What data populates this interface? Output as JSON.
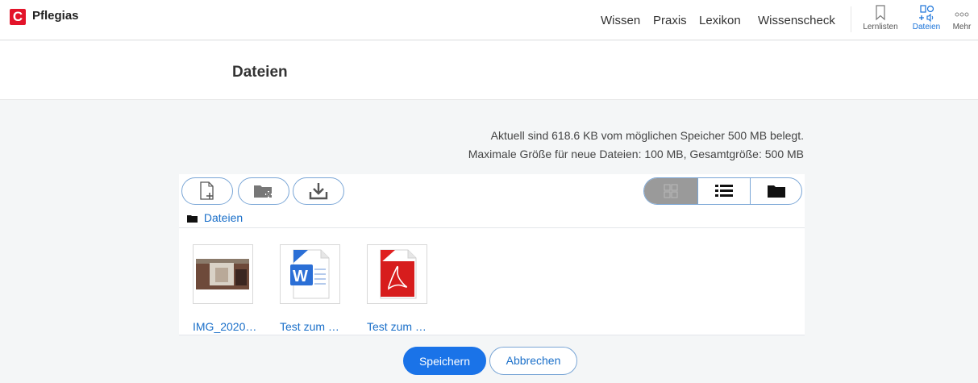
{
  "header": {
    "logo_letter": "C",
    "brand": "Pflegias",
    "nav": [
      "Wissen",
      "Praxis",
      "Lexikon",
      "Wissenscheck"
    ],
    "icon_items": [
      {
        "label": "Lernlisten",
        "icon": "bookmark-icon"
      },
      {
        "label": "Dateien",
        "icon": "files-media-icon",
        "active": true
      },
      {
        "label": "Mehr",
        "icon": "more-dots-icon"
      }
    ]
  },
  "page": {
    "title": "Dateien"
  },
  "storage": {
    "line1": "Aktuell sind 618.6 KB vom möglichen Speicher 500 MB belegt.",
    "line2": "Maximale Größe für neue Dateien: 100 MB, Gesamtgröße: 500 MB"
  },
  "toolbar": {
    "tools": [
      "add-file-icon",
      "add-folder-icon",
      "download-icon"
    ],
    "views": [
      "grid-view-icon",
      "list-view-icon",
      "folder-view-icon"
    ],
    "active_view": "grid-view-icon"
  },
  "breadcrumb": {
    "label": "Dateien"
  },
  "files": [
    {
      "name": "IMG_2020…",
      "type": "image"
    },
    {
      "name": "Test zum …",
      "type": "word"
    },
    {
      "name": "Test zum …",
      "type": "pdf"
    }
  ],
  "actions": {
    "save": "Speichern",
    "cancel": "Abbrechen"
  },
  "colors": {
    "accent": "#1a73e8",
    "brand_red": "#e3142a",
    "link": "#1a6fc9"
  }
}
